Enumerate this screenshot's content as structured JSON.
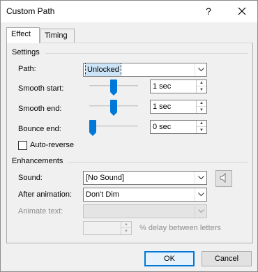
{
  "window": {
    "title": "Custom Path",
    "help_icon": "question-mark",
    "close_icon": "x"
  },
  "tabs": [
    {
      "label": "Effect",
      "active": true
    },
    {
      "label": "Timing",
      "active": false
    }
  ],
  "settings": {
    "group_label": "Settings",
    "path": {
      "label": "Path:",
      "value": "Unlocked"
    },
    "smooth_start": {
      "label": "Smooth start:",
      "value": "1 sec",
      "slider_fraction": 0.5
    },
    "smooth_end": {
      "label": "Smooth end:",
      "value": "1 sec",
      "slider_fraction": 0.5
    },
    "bounce_end": {
      "label": "Bounce end:",
      "value": "0 sec",
      "slider_fraction": 0.0
    },
    "auto_reverse": {
      "label": "Auto-reverse",
      "checked": false
    }
  },
  "enhancements": {
    "group_label": "Enhancements",
    "sound": {
      "label": "Sound:",
      "value": "[No Sound]",
      "icon": "speaker-icon"
    },
    "after_animation": {
      "label": "After animation:",
      "value": "Don't Dim"
    },
    "animate_text": {
      "label": "Animate text:",
      "value": "",
      "disabled": true
    },
    "delay": {
      "value": "",
      "suffix": "% delay between letters",
      "disabled": true
    }
  },
  "buttons": {
    "ok": "OK",
    "cancel": "Cancel"
  },
  "colors": {
    "accent": "#0078d7",
    "selection": "#cce4f7",
    "dialog_bg": "#f0f0f0"
  }
}
